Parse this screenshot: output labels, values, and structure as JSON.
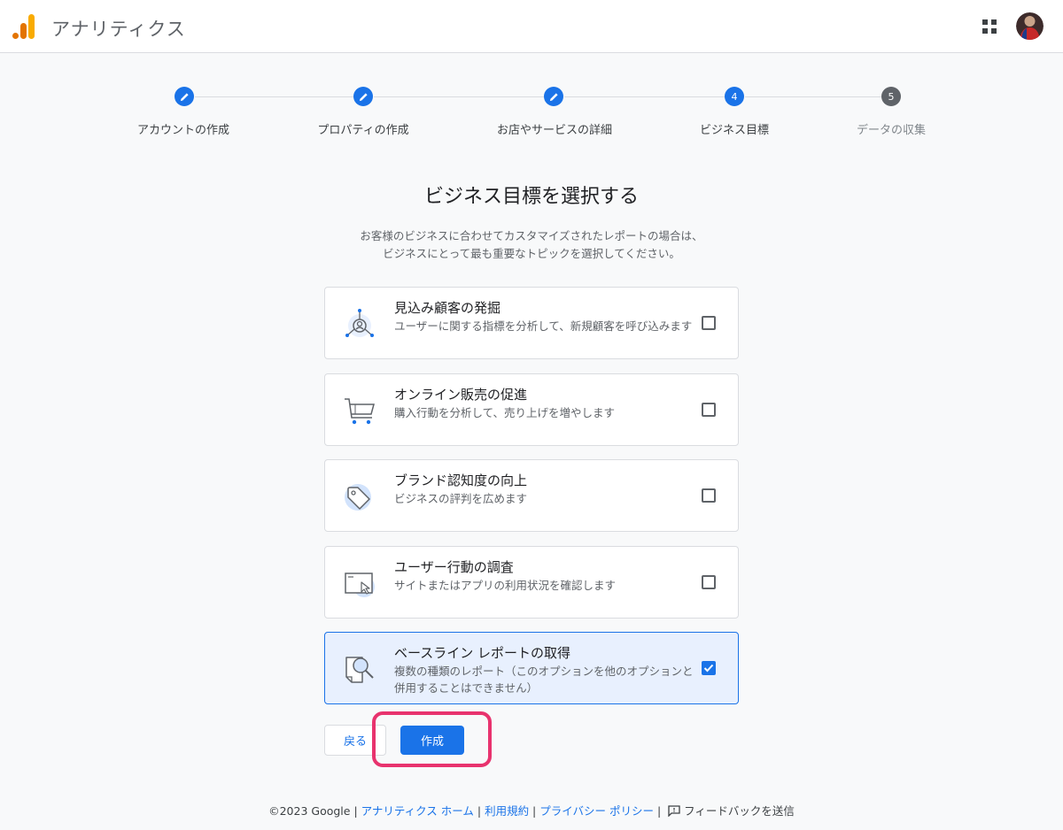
{
  "header": {
    "app_title": "アナリティクス"
  },
  "stepper": {
    "steps": [
      {
        "label": "アカウントの作成",
        "state": "done"
      },
      {
        "label": "プロパティの作成",
        "state": "done"
      },
      {
        "label": "お店やサービスの詳細",
        "state": "done"
      },
      {
        "label": "ビジネス目標",
        "number": "4",
        "state": "current"
      },
      {
        "label": "データの収集",
        "number": "5",
        "state": "upcoming"
      }
    ]
  },
  "main": {
    "heading": "ビジネス目標を選択する",
    "subtitle_line1": "お客様のビジネスに合わせてカスタマイズされたレポートの場合は、",
    "subtitle_line2": "ビジネスにとって最も重要なトピックを選択してください。"
  },
  "options": [
    {
      "title": "見込み顧客の発掘",
      "description": "ユーザーに関する指標を分析して、新規顧客を呼び込みます",
      "icon": "lead-generation-icon",
      "checked": false
    },
    {
      "title": "オンライン販売の促進",
      "description": "購入行動を分析して、売り上げを増やします",
      "icon": "shopping-cart-icon",
      "checked": false
    },
    {
      "title": "ブランド認知度の向上",
      "description": "ビジネスの評判を広めます",
      "icon": "tag-icon",
      "checked": false
    },
    {
      "title": "ユーザー行動の調査",
      "description": "サイトまたはアプリの利用状況を確認します",
      "icon": "browser-cursor-icon",
      "checked": false
    },
    {
      "title": "ベースライン レポートの取得",
      "description": "複数の種類のレポート（このオプションを他のオプションと併用することはできません）",
      "icon": "magnifier-report-icon",
      "checked": true
    }
  ],
  "actions": {
    "back_label": "戻る",
    "create_label": "作成"
  },
  "footer": {
    "copyright": "©2023 Google",
    "analytics_home": "アナリティクス ホーム",
    "terms": "利用規約",
    "privacy": "プライバシー ポリシー",
    "feedback": "フィードバックを送信"
  },
  "colors": {
    "accent": "#1a73e8",
    "highlight": "#e8336e",
    "inactive": "#5f6368"
  }
}
